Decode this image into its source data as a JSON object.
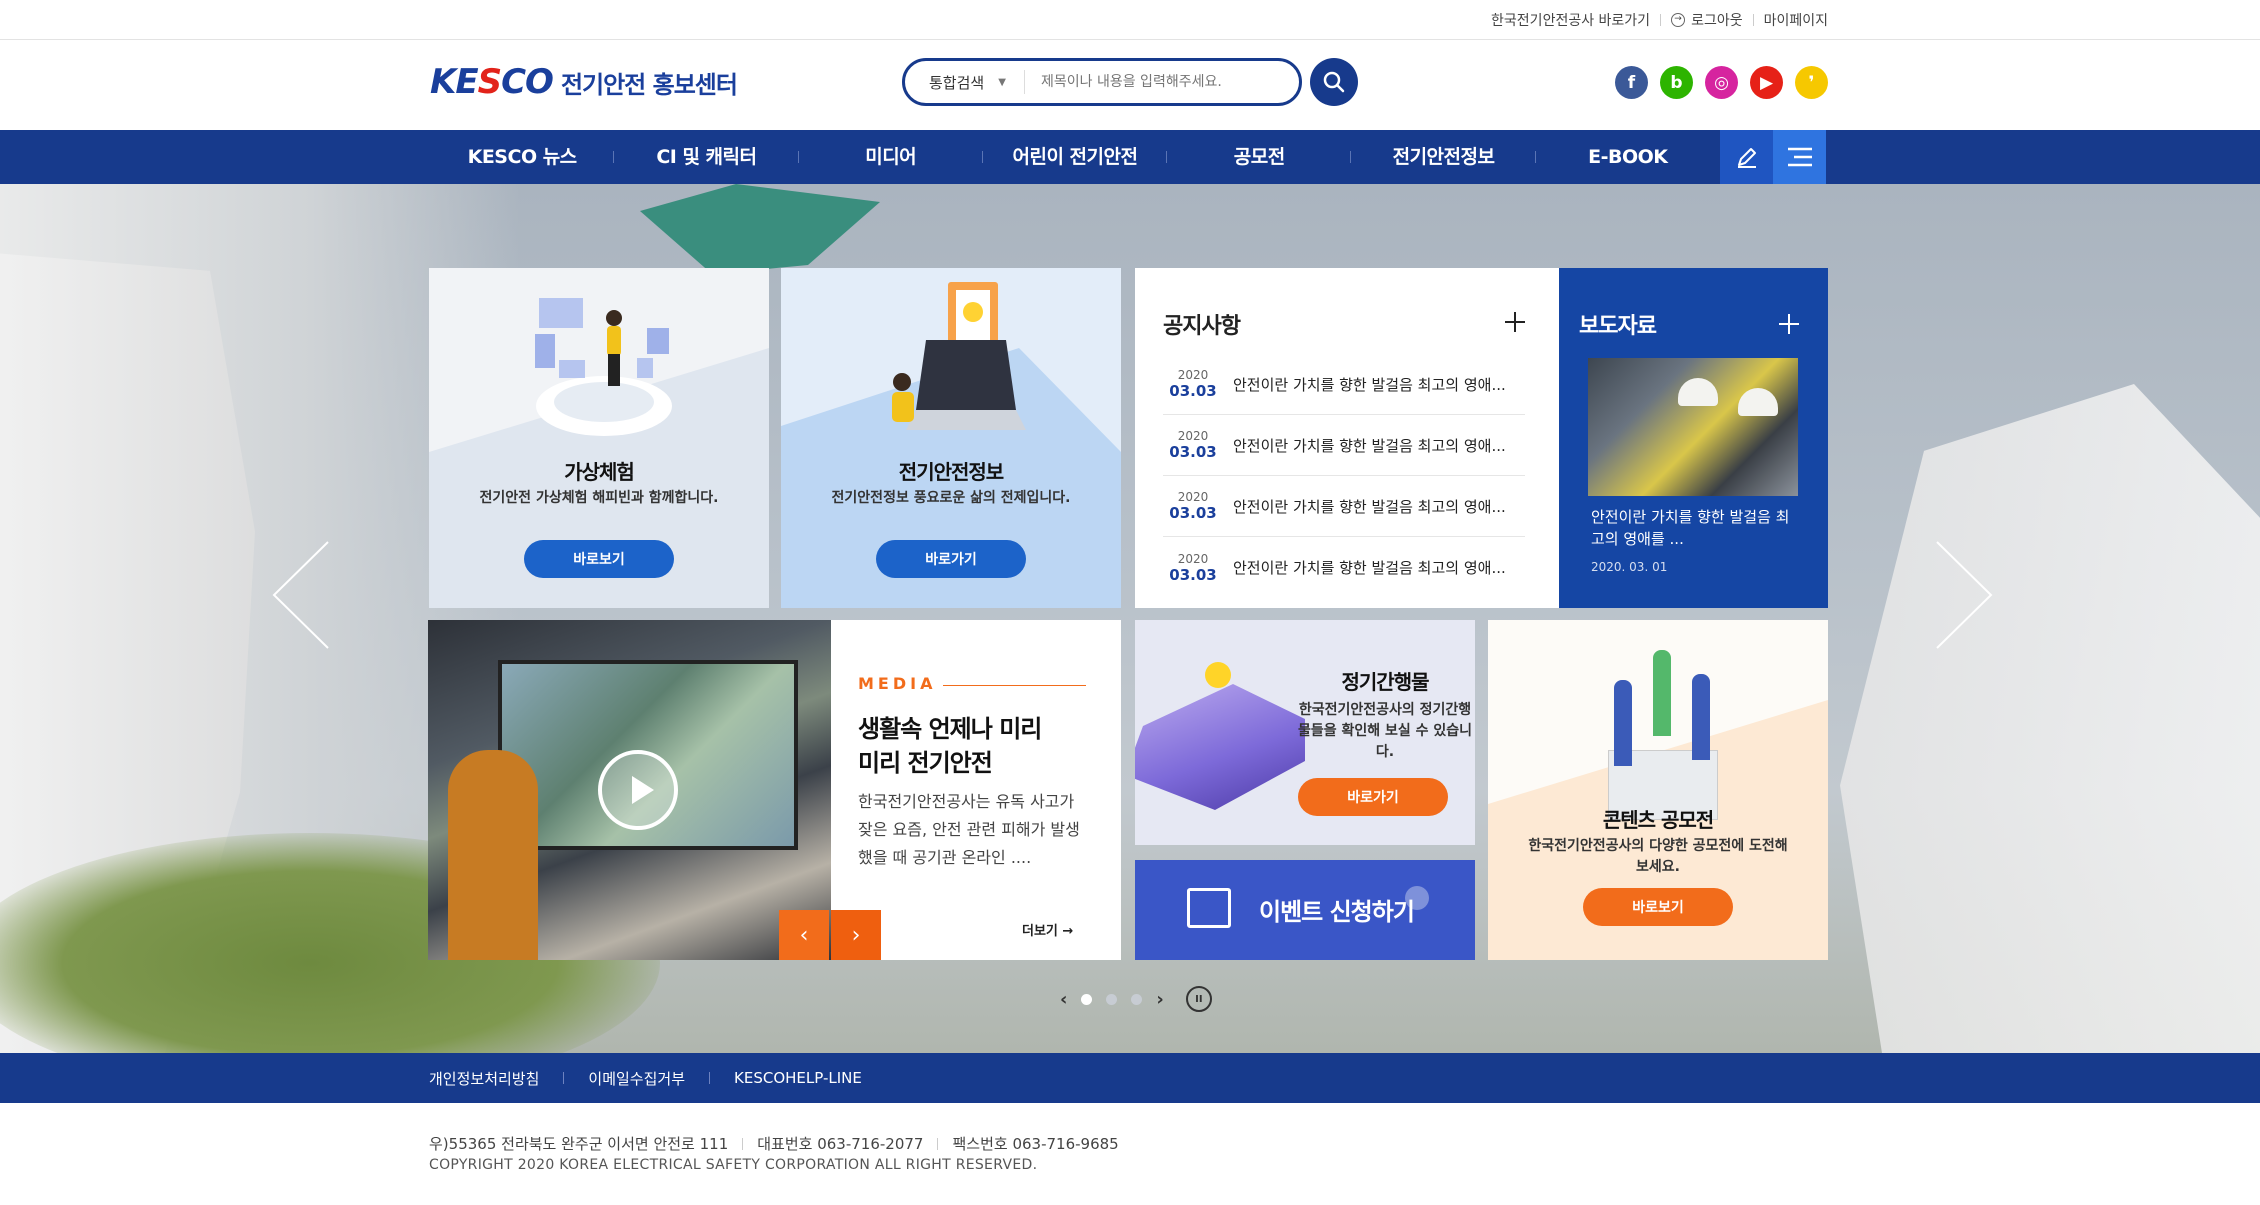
{
  "utility": {
    "kesco_link": "한국전기안전공사 바로가기",
    "logout": "로그아웃",
    "mypage": "마이페이지"
  },
  "header": {
    "logo_text_1": "KE",
    "logo_text_2": "S",
    "logo_text_3": "CO",
    "logo_title": "전기안전 홍보센터",
    "search_scope": "통합검색",
    "search_placeholder": "제목이나 내용을 입력해주세요.",
    "sns": [
      {
        "name": "facebook-icon",
        "glyph": "f",
        "color": "#3b5998"
      },
      {
        "name": "blog-icon",
        "glyph": "b",
        "color": "#2db400"
      },
      {
        "name": "instagram-icon",
        "glyph": "◎",
        "color": "#d6249f"
      },
      {
        "name": "youtube-icon",
        "glyph": "▶",
        "color": "#e62117"
      },
      {
        "name": "kakao-icon",
        "glyph": "❜",
        "color": "#f6c800"
      }
    ]
  },
  "nav": {
    "items": [
      "KESCO 뉴스",
      "CI 및 캐릭터",
      "미디어",
      "어린이 전기안전",
      "공모전",
      "전기안전정보",
      "E-BOOK"
    ]
  },
  "tiles": {
    "vr": {
      "title": "가상체험",
      "desc": "전기안전 가상체험 해피빈과 함께합니다.",
      "button": "바로보기"
    },
    "info": {
      "title": "전기안전정보",
      "desc": "전기안전정보 풍요로운 삶의 전제입니다.",
      "button": "바로가기"
    },
    "notice": {
      "title": "공지사항",
      "items": [
        {
          "year": "2020",
          "date": "03.03",
          "text": "안전이란 가치를 향한 발걸음 최고의 영애..."
        },
        {
          "year": "2020",
          "date": "03.03",
          "text": "안전이란 가치를 향한 발걸음 최고의 영애..."
        },
        {
          "year": "2020",
          "date": "03.03",
          "text": "안전이란 가치를 향한 발걸음 최고의 영애..."
        },
        {
          "year": "2020",
          "date": "03.03",
          "text": "안전이란 가치를 향한 발걸음 최고의 영애..."
        }
      ]
    },
    "press": {
      "title": "보도자료",
      "text": "안전이란 가치를 향한 발걸음 최고의 영애를 ...",
      "date": "2020. 03. 01"
    },
    "media": {
      "label": "MEDIA",
      "title": "생활속 언제나 미리 미리 전기안전",
      "desc": "한국전기안전공사는 유독 사고가 잦은 요즘, 안전 관련 피해가 발생했을 때 공기관 온라인 ....",
      "more": "더보기 →"
    },
    "publication": {
      "title": "정기간행물",
      "desc": "한국전기안전공사의 정기간행물들을 확인해 보실 수 있습니다.",
      "button": "바로가기"
    },
    "event": {
      "title": "이벤트 신청하기"
    },
    "contest": {
      "title": "콘텐츠 공모전",
      "desc": "한국전기안전공사의 다양한 공모전에 도전해보세요.",
      "button": "바로보기"
    }
  },
  "pager": {
    "pages": 3,
    "current": 1
  },
  "footer": {
    "links": [
      "개인정보처리방침",
      "이메일수집거부",
      "KESCOHELP-LINE"
    ],
    "address": "우)55365 전라북도 완주군 이서면 안전로 111",
    "phone": "대표번호 063-716-2077",
    "fax": "팩스번호 063-716-9685",
    "copyright": "COPYRIGHT 2020 KOREA ELECTRICAL SAFETY CORPORATION ALL RIGHT RESERVED."
  },
  "colors": {
    "primary": "#173a8c",
    "accent": "#f26c1b",
    "button_blue": "#1c63c9"
  }
}
